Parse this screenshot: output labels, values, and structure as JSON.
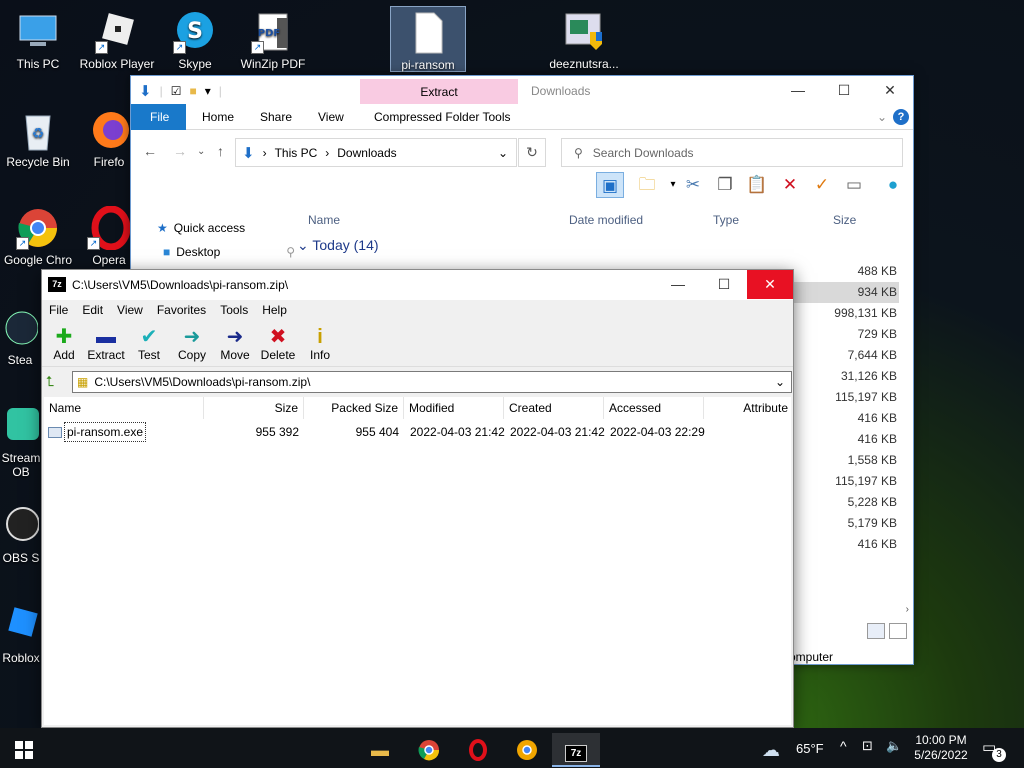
{
  "desktop": {
    "icons": [
      {
        "label": "This PC"
      },
      {
        "label": "Roblox Player"
      },
      {
        "label": "Skype"
      },
      {
        "label": "WinZip PDF"
      },
      {
        "label": "pi-ransom"
      },
      {
        "label": "deeznutsra..."
      },
      {
        "label": "Recycle Bin"
      },
      {
        "label": "Firefo"
      },
      {
        "label": "Google Chro"
      },
      {
        "label": "Opera"
      },
      {
        "label": "Stea"
      },
      {
        "label": "Stream OB"
      },
      {
        "label": "OBS S"
      },
      {
        "label": "Roblox"
      }
    ]
  },
  "explorer": {
    "title": "Downloads",
    "context_tab": "Extract",
    "ribbon_tabs": [
      "File",
      "Home",
      "Share",
      "View",
      "Compressed Folder Tools"
    ],
    "breadcrumb": [
      "This PC",
      "Downloads"
    ],
    "search_placeholder": "Search Downloads",
    "nav": [
      "Quick access",
      "Desktop"
    ],
    "columns": [
      "Name",
      "Date modified",
      "Type",
      "Size"
    ],
    "group": "Today (14)",
    "sizes": [
      "488 KB",
      "934 KB",
      "998,131 KB",
      "729 KB",
      "7,644 KB",
      "31,126 KB",
      "115,197 KB",
      "416 KB",
      "416 KB",
      "1,558 KB",
      "115,197 KB",
      "5,228 KB",
      "5,179 KB",
      "416 KB"
    ],
    "status": "omputer"
  },
  "zip": {
    "title": "C:\\Users\\VM5\\Downloads\\pi-ransom.zip\\",
    "menu": [
      "File",
      "Edit",
      "View",
      "Favorites",
      "Tools",
      "Help"
    ],
    "tools": [
      "Add",
      "Extract",
      "Test",
      "Copy",
      "Move",
      "Delete",
      "Info"
    ],
    "address": "C:\\Users\\VM5\\Downloads\\pi-ransom.zip\\",
    "columns": [
      "Name",
      "Size",
      "Packed Size",
      "Modified",
      "Created",
      "Accessed",
      "Attribute"
    ],
    "rows": [
      {
        "name": "pi-ransom.exe",
        "size": "955 392",
        "packed": "955 404",
        "modified": "2022-04-03 21:42",
        "created": "2022-04-03 21:42",
        "accessed": "2022-04-03 22:29"
      }
    ]
  },
  "taskbar": {
    "weather": "65°F",
    "time": "10:00 PM",
    "date": "5/26/2022",
    "notifications": "3"
  }
}
